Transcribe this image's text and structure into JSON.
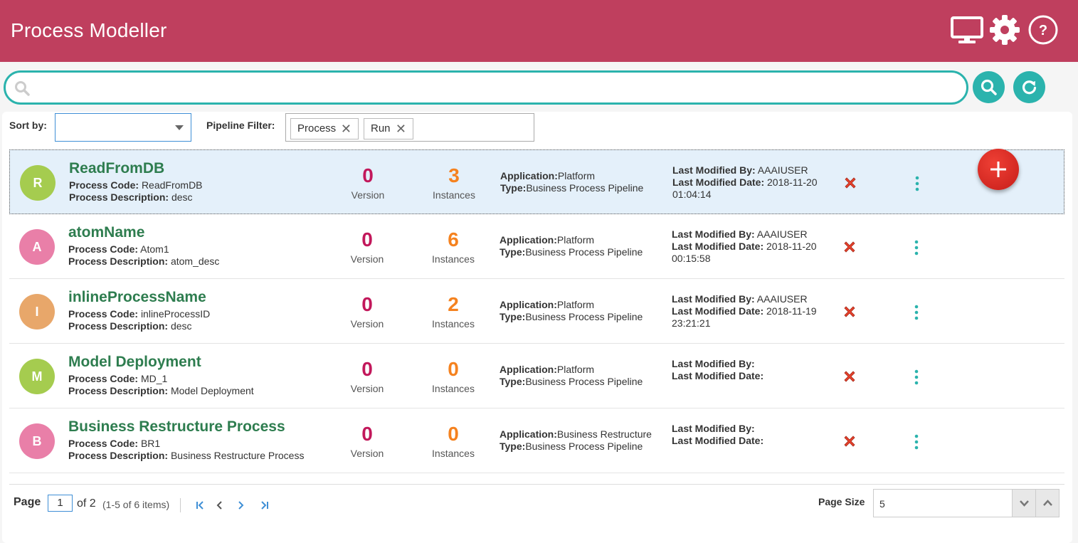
{
  "header": {
    "title": "Process Modeller"
  },
  "search": {
    "placeholder": "",
    "value": ""
  },
  "toolbar": {
    "sort_label": "Sort by:",
    "sort_value": "",
    "filter_label": "Pipeline Filter:",
    "filter_chips": [
      "Process",
      "Run"
    ]
  },
  "labels": {
    "process_code": "Process Code:",
    "process_description": "Process Description:",
    "version": "Version",
    "instances": "Instances",
    "application": "Application:",
    "type": "Type:",
    "last_modified_by": "Last Modified By:",
    "last_modified_date": "Last Modified Date:"
  },
  "processes": [
    {
      "initial": "R",
      "avatar_color": "#a5cc4f",
      "name": "ReadFromDB",
      "code": "ReadFromDB",
      "description": "desc",
      "version": "0",
      "instances": "3",
      "application": "Platform",
      "type": "Business Process Pipeline",
      "modified_by": "AAAIUSER",
      "modified_date": "2018-11-20",
      "modified_time": "01:04:14",
      "selected": true
    },
    {
      "initial": "A",
      "avatar_color": "#e97fa8",
      "name": "atomName",
      "code": "Atom1",
      "description": "atom_desc",
      "version": "0",
      "instances": "6",
      "application": "Platform",
      "type": "Business Process Pipeline",
      "modified_by": "AAAIUSER",
      "modified_date": "2018-11-20",
      "modified_time": "00:15:58",
      "selected": false
    },
    {
      "initial": "I",
      "avatar_color": "#e8a76a",
      "name": "inlineProcessName",
      "code": "inlineProcessID",
      "description": "desc",
      "version": "0",
      "instances": "2",
      "application": "Platform",
      "type": "Business Process Pipeline",
      "modified_by": "AAAIUSER",
      "modified_date": "2018-11-19",
      "modified_time": "23:21:21",
      "selected": false
    },
    {
      "initial": "M",
      "avatar_color": "#a5cc4f",
      "name": "Model Deployment",
      "code": "MD_1",
      "description": "Model Deployment",
      "version": "0",
      "instances": "0",
      "application": "Platform",
      "type": "Business Process Pipeline",
      "modified_by": "",
      "modified_date": "",
      "modified_time": "",
      "selected": false
    },
    {
      "initial": "B",
      "avatar_color": "#e97fa8",
      "name": "Business Restructure Process",
      "code": "BR1",
      "description": "Business Restructure Process",
      "version": "0",
      "instances": "0",
      "application": "Business Restructure",
      "type": "Business Process Pipeline",
      "modified_by": "",
      "modified_date": "",
      "modified_time": "",
      "selected": false
    }
  ],
  "pagination": {
    "page_label": "Page",
    "current_page": "1",
    "of_text": "of 2",
    "items_text": "(1-5 of 6 items)",
    "page_size_label": "Page Size",
    "page_size": "5"
  },
  "colors": {
    "header": "#bf3f5e",
    "accent": "#2bb3ad",
    "name_green": "#2e7d4f",
    "version": "#c2185b",
    "instances": "#f5821f",
    "fab": "#d7261e"
  }
}
